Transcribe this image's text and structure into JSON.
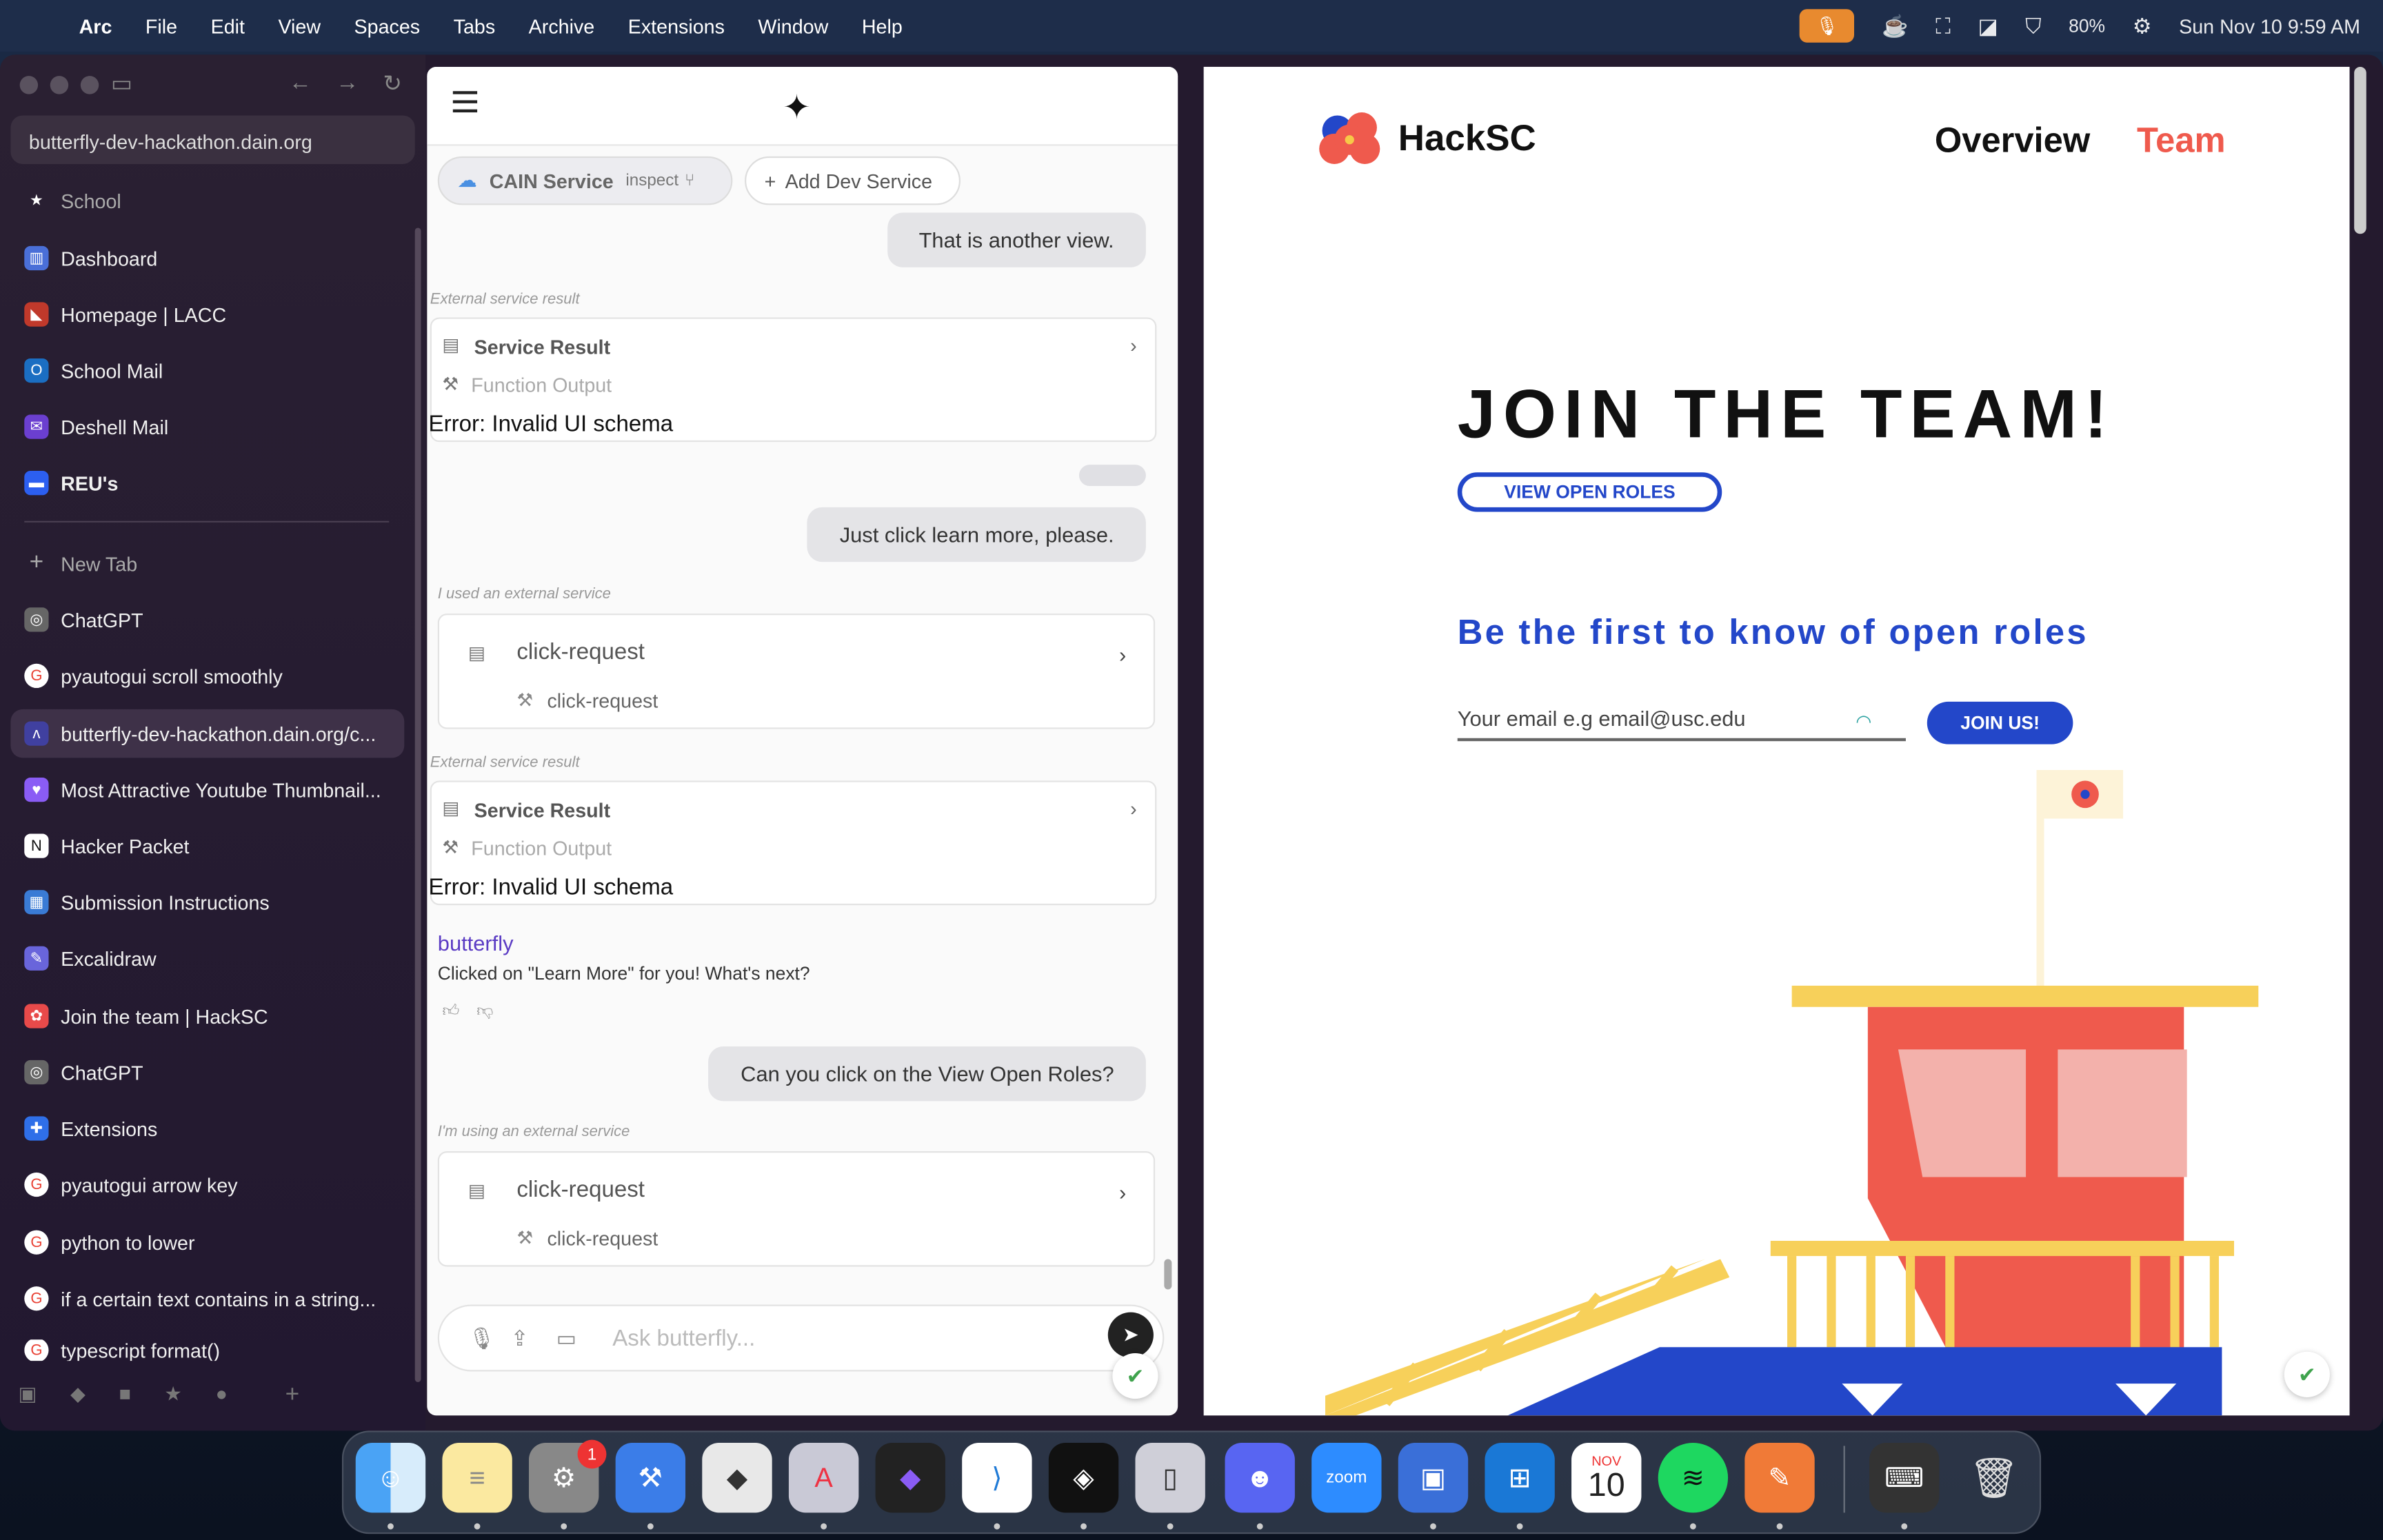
{
  "menubar": {
    "app": "Arc",
    "items": [
      "File",
      "Edit",
      "View",
      "Spaces",
      "Tabs",
      "Archive",
      "Extensions",
      "Window",
      "Help"
    ],
    "battery": "80%",
    "clock": "Sun Nov 10  9:59 AM"
  },
  "sidebar": {
    "url": "butterfly-dev-hackathon.dain.org",
    "space": "School",
    "pinned": [
      {
        "label": "Dashboard",
        "color": "#4a6fd8"
      },
      {
        "label": "Homepage | LACC",
        "color": "#c0392b"
      },
      {
        "label": "School Mail",
        "color": "#1b6ec2"
      },
      {
        "label": "Deshell Mail",
        "color": "#6b3fd0"
      },
      {
        "label": "REU's",
        "color": "#2c5ff0"
      }
    ],
    "new_tab": "New Tab",
    "tabs": [
      {
        "label": "ChatGPT",
        "color": "#666"
      },
      {
        "label": "pyautogui scroll smoothly",
        "color": "#e94235"
      },
      {
        "label": "butterfly-dev-hackathon.dain.org/c...",
        "color": "#4040a0"
      },
      {
        "label": "Most Attractive Youtube Thumbnail...",
        "color": "#8a5cf5"
      },
      {
        "label": "Hacker Packet",
        "color": "#333"
      },
      {
        "label": "Submission Instructions",
        "color": "#3a7bd5"
      },
      {
        "label": "Excalidraw",
        "color": "#6965db"
      },
      {
        "label": "Join the team | HackSC",
        "color": "#e84a4a"
      },
      {
        "label": "ChatGPT",
        "color": "#666"
      },
      {
        "label": "Extensions",
        "color": "#2f6fe8"
      },
      {
        "label": "pyautogui arrow key",
        "color": "#e94235"
      },
      {
        "label": "python to lower",
        "color": "#e94235"
      },
      {
        "label": "if a certain text contains in a string...",
        "color": "#e94235"
      },
      {
        "label": "typescript  format()",
        "color": "#e94235"
      }
    ]
  },
  "chat": {
    "service_pill": "CAIN Service",
    "inspect": "inspect",
    "add_service": "Add Dev Service",
    "msg1": "That is another view.",
    "ext1": "External service result",
    "result_title": "Service Result",
    "function_output": "Function Output",
    "error": "Error: Invalid UI schema",
    "msg2": "Just click learn more, please.",
    "ext2": "I used an external service",
    "click_request": "click-request",
    "ext3": "External service result",
    "bot_name": "butterfly",
    "bot_msg": "Clicked on \"Learn More\" for you! What's next?",
    "msg3": "Can you click on the View Open Roles?",
    "ext4": "I'm using an external service",
    "placeholder": "Ask butterfly..."
  },
  "hacksc": {
    "logo": "HackSC",
    "nav_overview": "Overview",
    "nav_team": "Team",
    "headline": "JOIN THE TEAM!",
    "view_roles": "VIEW OPEN ROLES",
    "first": "Be the first to know of open roles",
    "email_placeholder": "Your email e.g email@usc.edu",
    "join_button": "JOIN US!"
  },
  "dock": {
    "calendar_month": "NOV",
    "calendar_day": "10",
    "badge": "1",
    "zoom": "zoom"
  },
  "colors": {
    "accent_blue": "#2347c9",
    "accent_red": "#ef5a4d",
    "chat_purple": "#5b3cc4"
  }
}
